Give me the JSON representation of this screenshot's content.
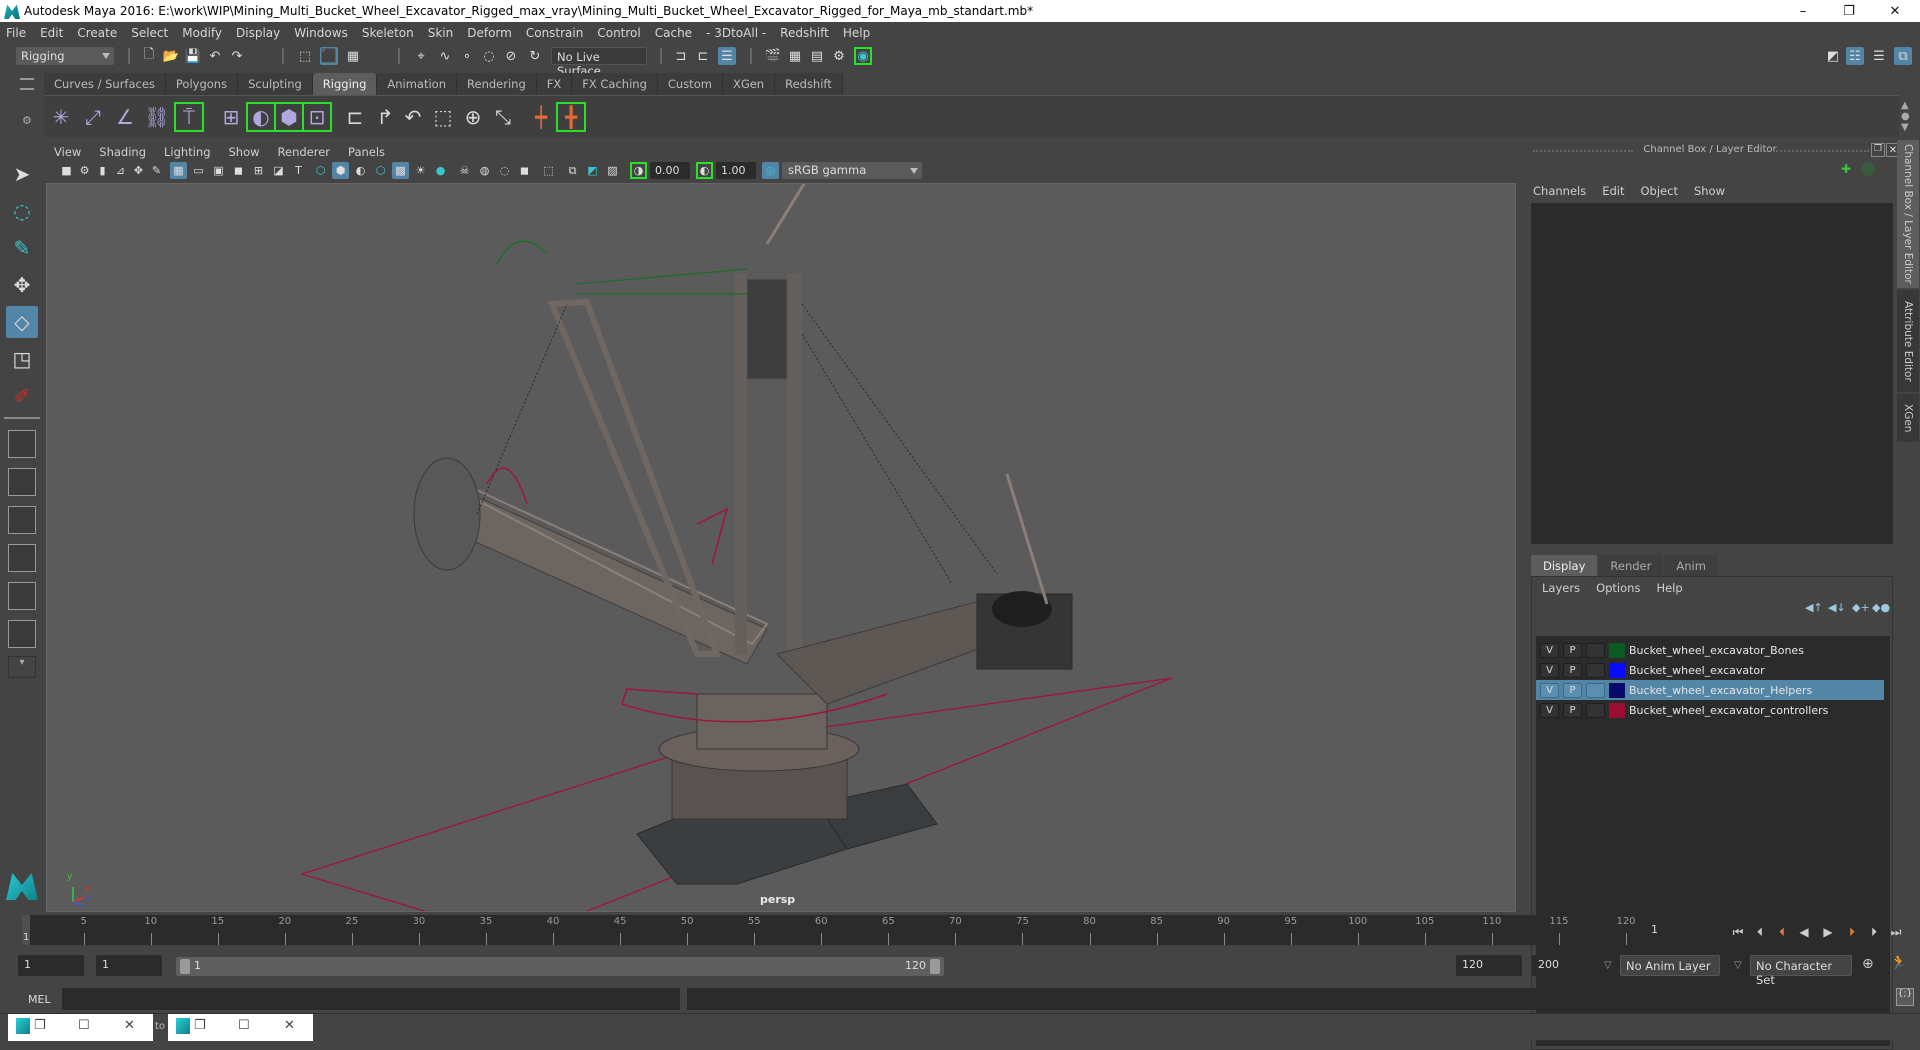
{
  "window": {
    "title": "Autodesk Maya 2016: E:\\work\\WIP\\Mining_Multi_Bucket_Wheel_Excavator_Rigged_max_vray\\Mining_Multi_Bucket_Wheel_Excavator_Rigged_for_Maya_mb_standart.mb*",
    "controls": {
      "minimize": "–",
      "restore": "❐",
      "close": "✕"
    }
  },
  "menubar": [
    "File",
    "Edit",
    "Create",
    "Select",
    "Modify",
    "Display",
    "Windows",
    "Skeleton",
    "Skin",
    "Deform",
    "Constrain",
    "Control",
    "Cache",
    "- 3DtoAll -",
    "Redshift",
    "Help"
  ],
  "statusline": {
    "menuset": "Rigging",
    "live_surface": "No Live Surface"
  },
  "shelf": {
    "tabs": [
      {
        "label": "Curves / Surfaces",
        "active": false
      },
      {
        "label": "Polygons",
        "active": false
      },
      {
        "label": "Sculpting",
        "active": false
      },
      {
        "label": "Rigging",
        "active": true
      },
      {
        "label": "Animation",
        "active": false
      },
      {
        "label": "Rendering",
        "active": false
      },
      {
        "label": "FX",
        "active": false
      },
      {
        "label": "FX Caching",
        "active": false
      },
      {
        "label": "Custom",
        "active": false
      },
      {
        "label": "XGen",
        "active": false
      },
      {
        "label": "Redshift",
        "active": false
      }
    ],
    "icons": [
      "joint-tool-icon",
      "insert-joint-icon",
      "ik-handle-icon",
      "ik-spline-icon",
      "quick-rig-icon",
      "skin-bind-icon",
      "smooth-bind-icon",
      "lattice-icon",
      "cluster-icon",
      "parent-constraint-icon",
      "point-constraint-icon",
      "orient-constraint-icon",
      "scale-constraint-icon",
      "aim-constraint-icon",
      "pole-vector-icon",
      "hik-skeleton-icon",
      "hik-character-icon"
    ]
  },
  "viewport": {
    "menu": [
      "View",
      "Shading",
      "Lighting",
      "Show",
      "Renderer",
      "Panels"
    ],
    "exposure": "0.00",
    "gamma": "1.00",
    "color_space": "sRGB gamma",
    "camera_label": "persp",
    "axes": {
      "x": "x",
      "y": "y",
      "z": "z"
    }
  },
  "channel_box": {
    "title": "Channel Box / Layer Editor",
    "menu": [
      "Channels",
      "Edit",
      "Object",
      "Show"
    ]
  },
  "layer_editor": {
    "tabs": [
      {
        "label": "Display",
        "active": true
      },
      {
        "label": "Render",
        "active": false
      },
      {
        "label": "Anim",
        "active": false
      }
    ],
    "menu": [
      "Layers",
      "Options",
      "Help"
    ],
    "layers": [
      {
        "v": "V",
        "p": "P",
        "color": "#0b5a24",
        "name": "Bucket_wheel_excavator_Bones",
        "selected": false
      },
      {
        "v": "V",
        "p": "P",
        "color": "#0a0aff",
        "name": "Bucket_wheel_excavator",
        "selected": false
      },
      {
        "v": "V",
        "p": "P",
        "color": "#060a6a",
        "name": "Bucket_wheel_excavator_Helpers",
        "selected": true
      },
      {
        "v": "V",
        "p": "P",
        "color": "#9c0d32",
        "name": "Bucket_wheel_excavator_controllers",
        "selected": false
      }
    ]
  },
  "side_tabs": [
    {
      "label": "Channel Box / Layer Editor",
      "active": true
    },
    {
      "label": "Attribute Editor",
      "active": false
    },
    {
      "label": "XGen",
      "active": false
    }
  ],
  "timeline": {
    "ticks": [
      5,
      10,
      15,
      20,
      25,
      30,
      35,
      40,
      45,
      50,
      55,
      60,
      65,
      70,
      75,
      80,
      85,
      90,
      95,
      100,
      105,
      110,
      115,
      120
    ],
    "start": 1,
    "end": 120,
    "current_frame": "1",
    "current_marker": "1"
  },
  "range": {
    "start_field": "1",
    "playback_start": "1",
    "slider_start": "1",
    "slider_end": "120",
    "playback_end": "120",
    "end_field": "200",
    "anim_layer": "No Anim Layer",
    "character_set": "No Character Set"
  },
  "command_line": {
    "lang": "MEL"
  },
  "taskbar": {
    "between_label": "to"
  },
  "colors": {
    "accent": "#5285a6",
    "shelf_highlight": "#2be02b",
    "controller_red": "#a0143c"
  }
}
